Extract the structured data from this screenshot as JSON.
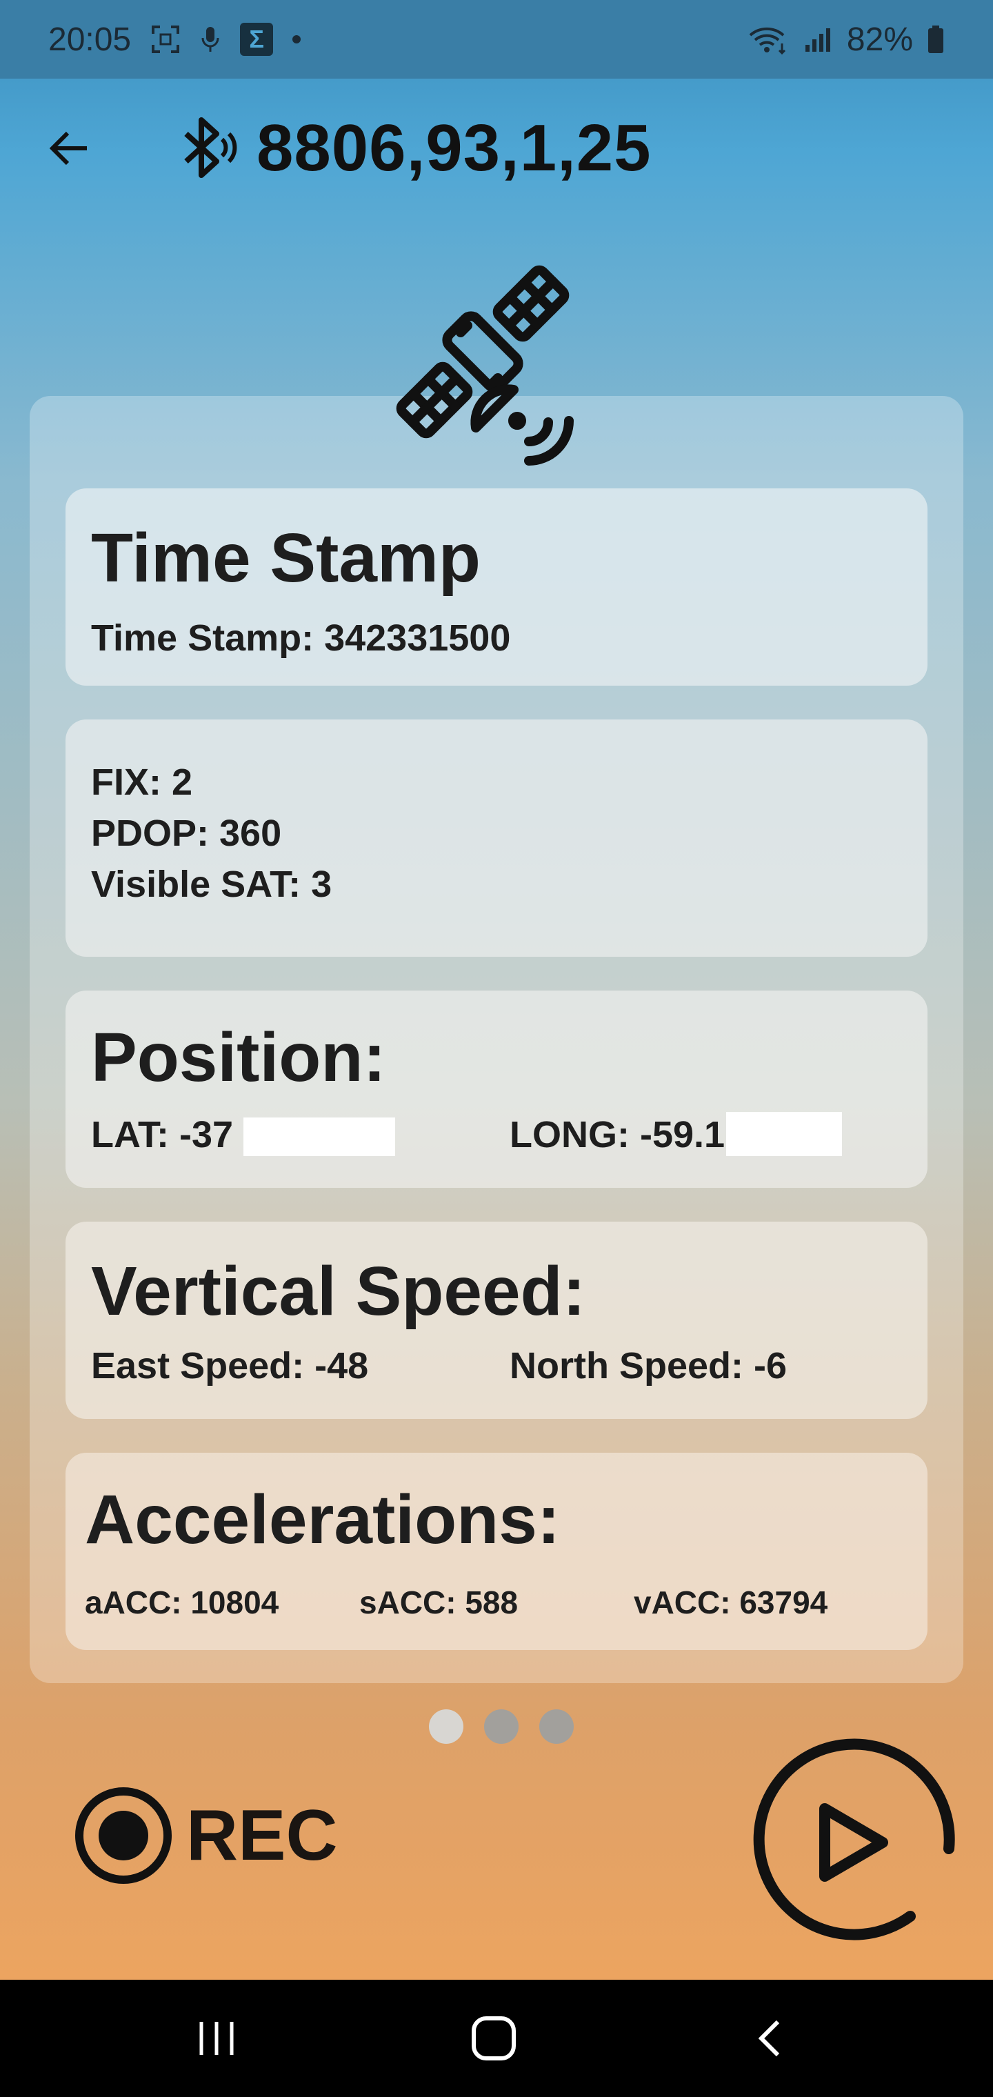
{
  "status_bar": {
    "time": "20:05",
    "icons": [
      "screenshot-icon",
      "mic-icon",
      "sigma-app-icon",
      "notification-dot-icon",
      "wifi-icon",
      "signal-icon",
      "battery-icon"
    ],
    "battery": "82%"
  },
  "header": {
    "title": "8806,93,1,25",
    "back_icon": "arrow-left-icon",
    "bluetooth_icon": "bluetooth-audio-icon"
  },
  "illustration": "satellite-icon",
  "cards": {
    "timestamp": {
      "title": "Time Stamp",
      "line": "Time Stamp: 342331500"
    },
    "fix": {
      "fix": "FIX:  2",
      "pdop": "PDOP: 360",
      "visible_sat": "Visible SAT: 3"
    },
    "position": {
      "title": "Position:",
      "lat": "LAT: -37",
      "long": "LONG: -59.1"
    },
    "vertical_speed": {
      "title": "Vertical Speed:",
      "east": "East Speed: -48",
      "north": "North Speed: -6"
    },
    "accelerations": {
      "title": "Accelerations:",
      "aacc": "aACC: 10804",
      "sacc": "sACC: 588",
      "vacc": "vACC: 63794"
    }
  },
  "pager": {
    "count": 3,
    "active": 0
  },
  "controls": {
    "rec_label": "REC",
    "rec_icon": "record-icon",
    "play_icon": "play-icon"
  },
  "colors": {
    "status_bar": "#3a7ea6",
    "gradient_top": "#4ea6d4",
    "gradient_bottom": "#eca460",
    "text": "#1e1e1e"
  }
}
